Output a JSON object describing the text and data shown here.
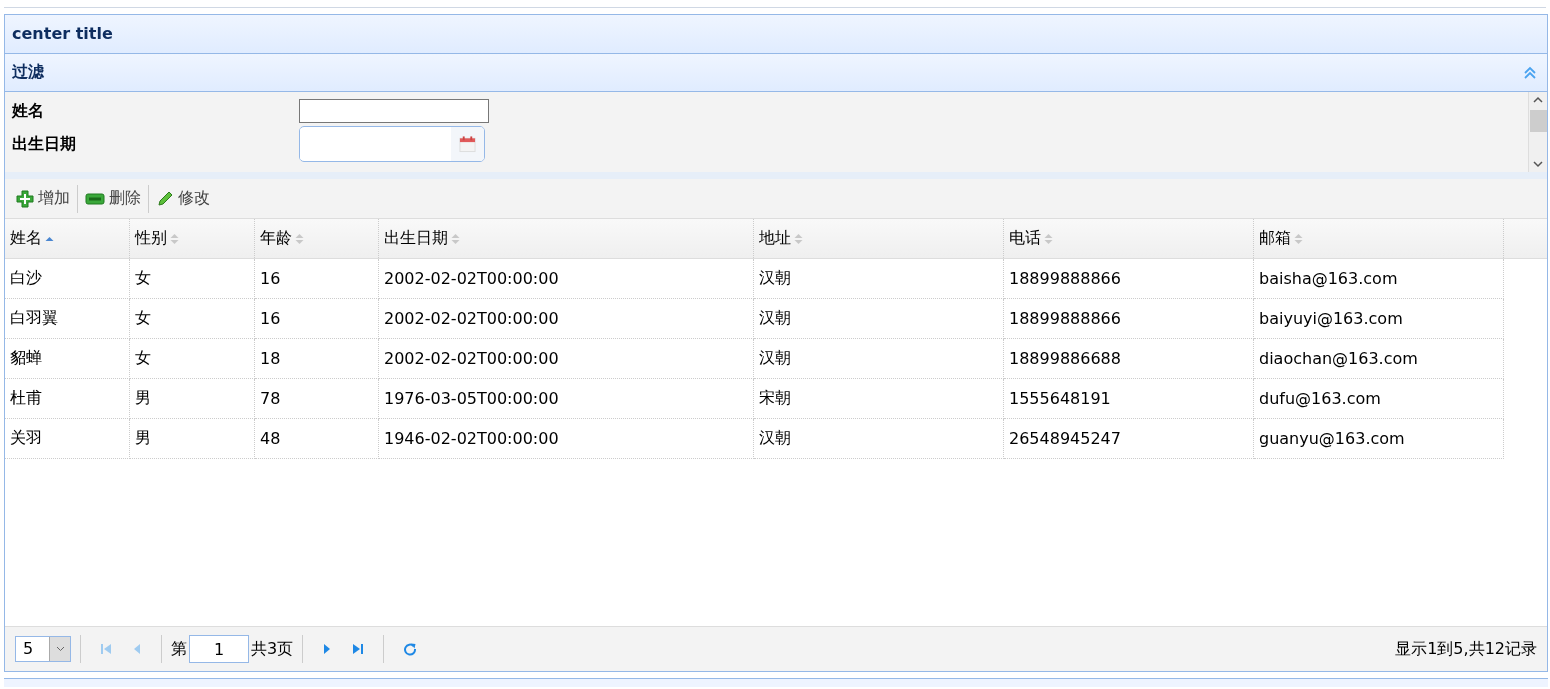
{
  "panel": {
    "title": "center title"
  },
  "filter": {
    "title": "过滤",
    "expanded": true,
    "fields": [
      {
        "label": "姓名",
        "kind": "text"
      },
      {
        "label": "出生日期",
        "kind": "date"
      }
    ]
  },
  "toolbar": [
    {
      "label": "增加",
      "kind": "add"
    },
    {
      "label": "删除",
      "kind": "remove"
    },
    {
      "label": "修改",
      "kind": "edit"
    }
  ],
  "table": {
    "columns": [
      {
        "label": "姓名",
        "sorted": true
      },
      {
        "label": "性别",
        "sorted": false
      },
      {
        "label": "年龄",
        "sorted": false
      },
      {
        "label": "出生日期",
        "sorted": false
      },
      {
        "label": "地址",
        "sorted": false
      },
      {
        "label": "电话",
        "sorted": false
      },
      {
        "label": "邮箱",
        "sorted": false
      }
    ],
    "rows": [
      [
        "白沙",
        "女",
        "16",
        "2002-02-02T00:00:00",
        "汉朝",
        "18899888866",
        "baisha@163.com"
      ],
      [
        "白羽翼",
        "女",
        "16",
        "2002-02-02T00:00:00",
        "汉朝",
        "18899888866",
        "baiyuyi@163.com"
      ],
      [
        "貂蝉",
        "女",
        "18",
        "2002-02-02T00:00:00",
        "汉朝",
        "18899886688",
        "diaochan@163.com"
      ],
      [
        "杜甫",
        "男",
        "78",
        "1976-03-05T00:00:00",
        "宋朝",
        "1555648191",
        "dufu@163.com"
      ],
      [
        "关羽",
        "男",
        "48",
        "1946-02-02T00:00:00",
        "汉朝",
        "26548945247",
        "guanyu@163.com"
      ]
    ]
  },
  "pager": {
    "page_size": "5",
    "page_prefix": "第",
    "page": "1",
    "page_total": "共3页",
    "summary": "显示1到5,共12记录"
  }
}
